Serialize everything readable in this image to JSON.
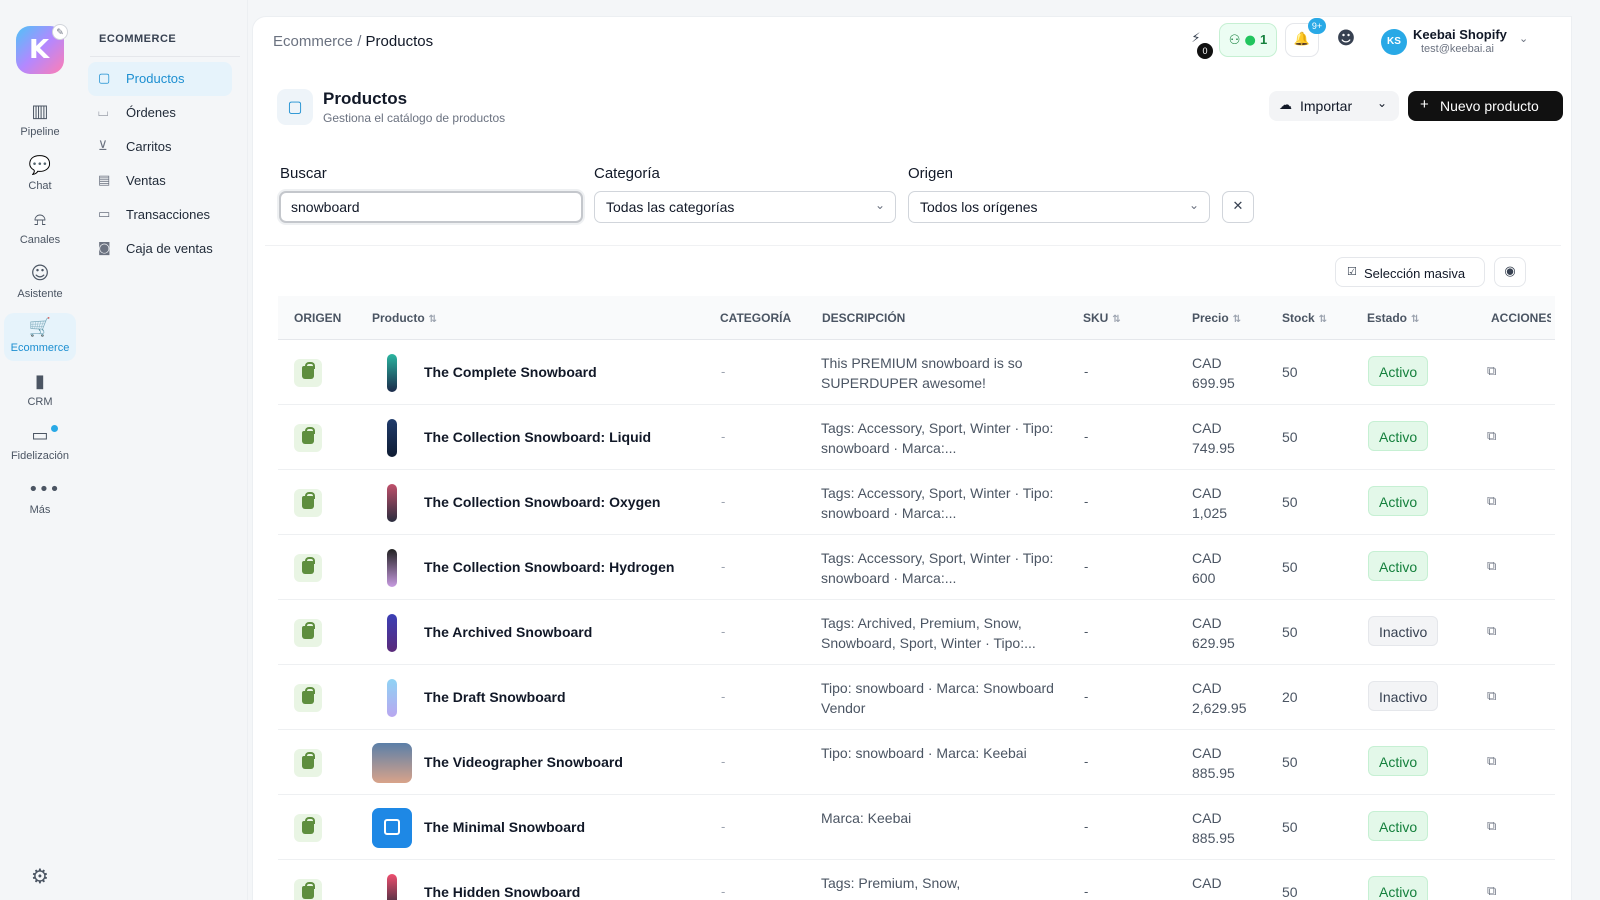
{
  "rail": {
    "items": [
      {
        "label": "Pipeline",
        "icon": "pipeline-icon",
        "glyph": "▥"
      },
      {
        "label": "Chat",
        "icon": "chat-icon",
        "glyph": "💬"
      },
      {
        "label": "Canales",
        "icon": "channels-icon",
        "glyph": "⍾"
      },
      {
        "label": "Asistente",
        "icon": "assistant-icon",
        "glyph": "☺"
      },
      {
        "label": "Ecommerce",
        "icon": "cart-icon",
        "glyph": "🛒"
      },
      {
        "label": "CRM",
        "icon": "crm-icon",
        "glyph": "▮"
      },
      {
        "label": "Fidelización",
        "icon": "wallet-icon",
        "glyph": "▭"
      },
      {
        "label": "Más",
        "icon": "more-icon",
        "glyph": "•••"
      }
    ]
  },
  "subnav": {
    "section": "ECOMMERCE",
    "items": [
      {
        "label": "Productos",
        "icon": "box-icon",
        "glyph": "▢"
      },
      {
        "label": "Órdenes",
        "icon": "basket-icon",
        "glyph": "⌴"
      },
      {
        "label": "Carritos",
        "icon": "cart-icon",
        "glyph": "⊻"
      },
      {
        "label": "Ventas",
        "icon": "calendar-icon",
        "glyph": "▤"
      },
      {
        "label": "Transacciones",
        "icon": "card-icon",
        "glyph": "▭"
      },
      {
        "label": "Caja de ventas",
        "icon": "cash-icon",
        "glyph": "◙"
      }
    ]
  },
  "breadcrumb": {
    "parent": "Ecommerce",
    "sep": "/",
    "current": "Productos"
  },
  "topbar": {
    "tasks_count": "0",
    "online_count": "1",
    "notifications": "9+",
    "user": {
      "initials": "KS",
      "name": "Keebai Shopify",
      "email": "test@keebai.ai"
    }
  },
  "page": {
    "title": "Productos",
    "subtitle": "Gestiona el catálogo de productos"
  },
  "actions": {
    "import": "Importar",
    "new": "Nuevo producto",
    "mass": "Selección masiva"
  },
  "filters": {
    "search_label": "Buscar",
    "search_value": "snowboard",
    "category_label": "Categoría",
    "category_value": "Todas las categorías",
    "origin_label": "Origen",
    "origin_value": "Todos los orígenes"
  },
  "table": {
    "headers": {
      "origin": "ORIGEN",
      "product": "Producto",
      "category": "CATEGORÍA",
      "description": "DESCRIPCIÓN",
      "sku": "SKU",
      "price": "Precio",
      "stock": "Stock",
      "status": "Estado",
      "actions": "ACCIONES"
    },
    "rows": [
      {
        "name": "The Complete Snowboard",
        "category": "-",
        "description": "This PREMIUM snowboard is so SUPERDUPER awesome!",
        "sku": "-",
        "price": "CAD\n699.95",
        "stock": "50",
        "status": "Activo",
        "active": true,
        "colors": [
          "#2bb5a0",
          "#1b2a4a"
        ]
      },
      {
        "name": "The Collection Snowboard: Liquid",
        "category": "-",
        "description": "Tags: Accessory, Sport, Winter · Tipo: snowboard · Marca:...",
        "sku": "-",
        "price": "CAD\n749.95",
        "stock": "50",
        "status": "Activo",
        "active": true,
        "colors": [
          "#1f3b6b",
          "#0f1c33"
        ]
      },
      {
        "name": "The Collection Snowboard: Oxygen",
        "category": "-",
        "description": "Tags: Accessory, Sport, Winter · Tipo: snowboard · Marca:...",
        "sku": "-",
        "price": "CAD\n1,025",
        "stock": "50",
        "status": "Activo",
        "active": true,
        "colors": [
          "#c0506b",
          "#2a2d3e"
        ]
      },
      {
        "name": "The Collection Snowboard: Hydrogen",
        "category": "-",
        "description": "Tags: Accessory, Sport, Winter · Tipo: snowboard · Marca:...",
        "sku": "-",
        "price": "CAD\n600",
        "stock": "50",
        "status": "Activo",
        "active": true,
        "colors": [
          "#222222",
          "#c79be0"
        ]
      },
      {
        "name": "The Archived Snowboard",
        "category": "-",
        "description": "Tags: Archived, Premium, Snow, Snowboard, Sport, Winter · Tipo:...",
        "sku": "-",
        "price": "CAD\n629.95",
        "stock": "50",
        "status": "Inactivo",
        "active": false,
        "colors": [
          "#3b3fb5",
          "#5a2a7a"
        ]
      },
      {
        "name": "The Draft Snowboard",
        "category": "-",
        "description": "Tipo: snowboard · Marca: Snowboard Vendor",
        "sku": "-",
        "price": "CAD\n2,629.95",
        "stock": "20",
        "status": "Inactivo",
        "active": false,
        "colors": [
          "#8fd3f4",
          "#b9a7f0"
        ]
      },
      {
        "name": "The Videographer Snowboard",
        "category": "-",
        "description": "Tipo: snowboard · Marca: Keebai",
        "sku": "-",
        "price": "CAD\n885.95",
        "stock": "50",
        "status": "Activo",
        "active": true,
        "colors": [
          "#5b7fa8",
          "#d9a38a"
        ]
      },
      {
        "name": "The Minimal Snowboard",
        "category": "-",
        "description": "Marca: Keebai",
        "sku": "-",
        "price": "CAD\n885.95",
        "stock": "50",
        "status": "Activo",
        "active": true,
        "colors": [
          "#1e88e5",
          "#1565c0"
        ]
      },
      {
        "name": "The Hidden Snowboard",
        "category": "-",
        "description": "Tags: Premium, Snow,",
        "sku": "-",
        "price": "CAD\n",
        "stock": "50",
        "status": "Activo",
        "active": true,
        "colors": [
          "#ef4f6f",
          "#1f2937"
        ]
      }
    ]
  }
}
